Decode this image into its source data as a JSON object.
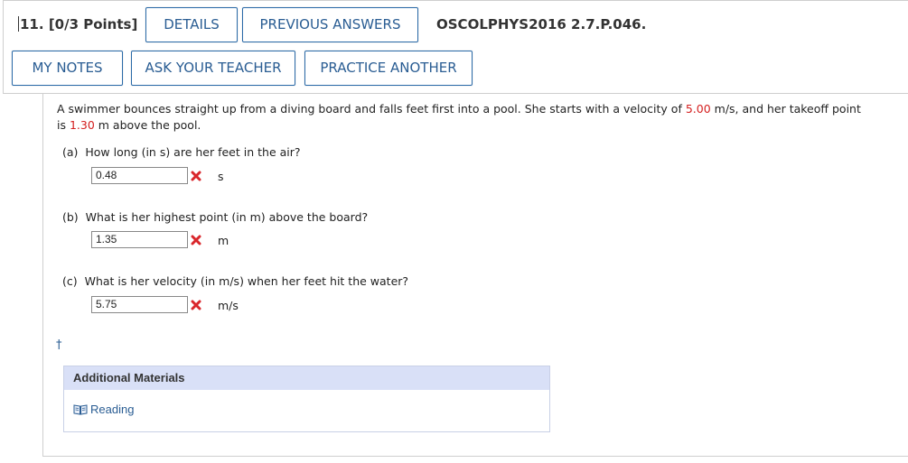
{
  "header": {
    "question_number": "11.",
    "points": "[0/3 Points]",
    "details_label": "DETAILS",
    "previous_answers_label": "PREVIOUS ANSWERS",
    "problem_code": "OSCOLPHYS2016 2.7.P.046.",
    "my_notes_label": "MY NOTES",
    "ask_teacher_label": "ASK YOUR TEACHER",
    "practice_another_label": "PRACTICE ANOTHER"
  },
  "problem": {
    "intro_1": "A swimmer bounces straight up from a diving board and falls feet first into a pool. She starts with a velocity of ",
    "velocity": "5.00",
    "intro_2": " m/s, and her takeoff point",
    "intro_3": "is ",
    "height": "1.30",
    "intro_4": " m above the pool."
  },
  "parts": [
    {
      "label": "(a)",
      "question": "How long (in s) are her feet in the air?",
      "answer": "0.48",
      "unit": "s",
      "status": "incorrect"
    },
    {
      "label": "(b)",
      "question": "What is her highest point (in m) above the board?",
      "answer": "1.35",
      "unit": "m",
      "status": "incorrect"
    },
    {
      "label": "(c)",
      "question": "What is her velocity (in m/s) when her feet hit the water?",
      "answer": "5.75",
      "unit": "m/s",
      "status": "incorrect"
    }
  ],
  "footnote_marker": "†",
  "additional_materials": {
    "title": "Additional Materials",
    "link_label": "Reading",
    "link_icon": "book-icon"
  },
  "colors": {
    "accent": "#2a5d93",
    "highlight": "#d42020",
    "incorrect": "#d9262b"
  }
}
